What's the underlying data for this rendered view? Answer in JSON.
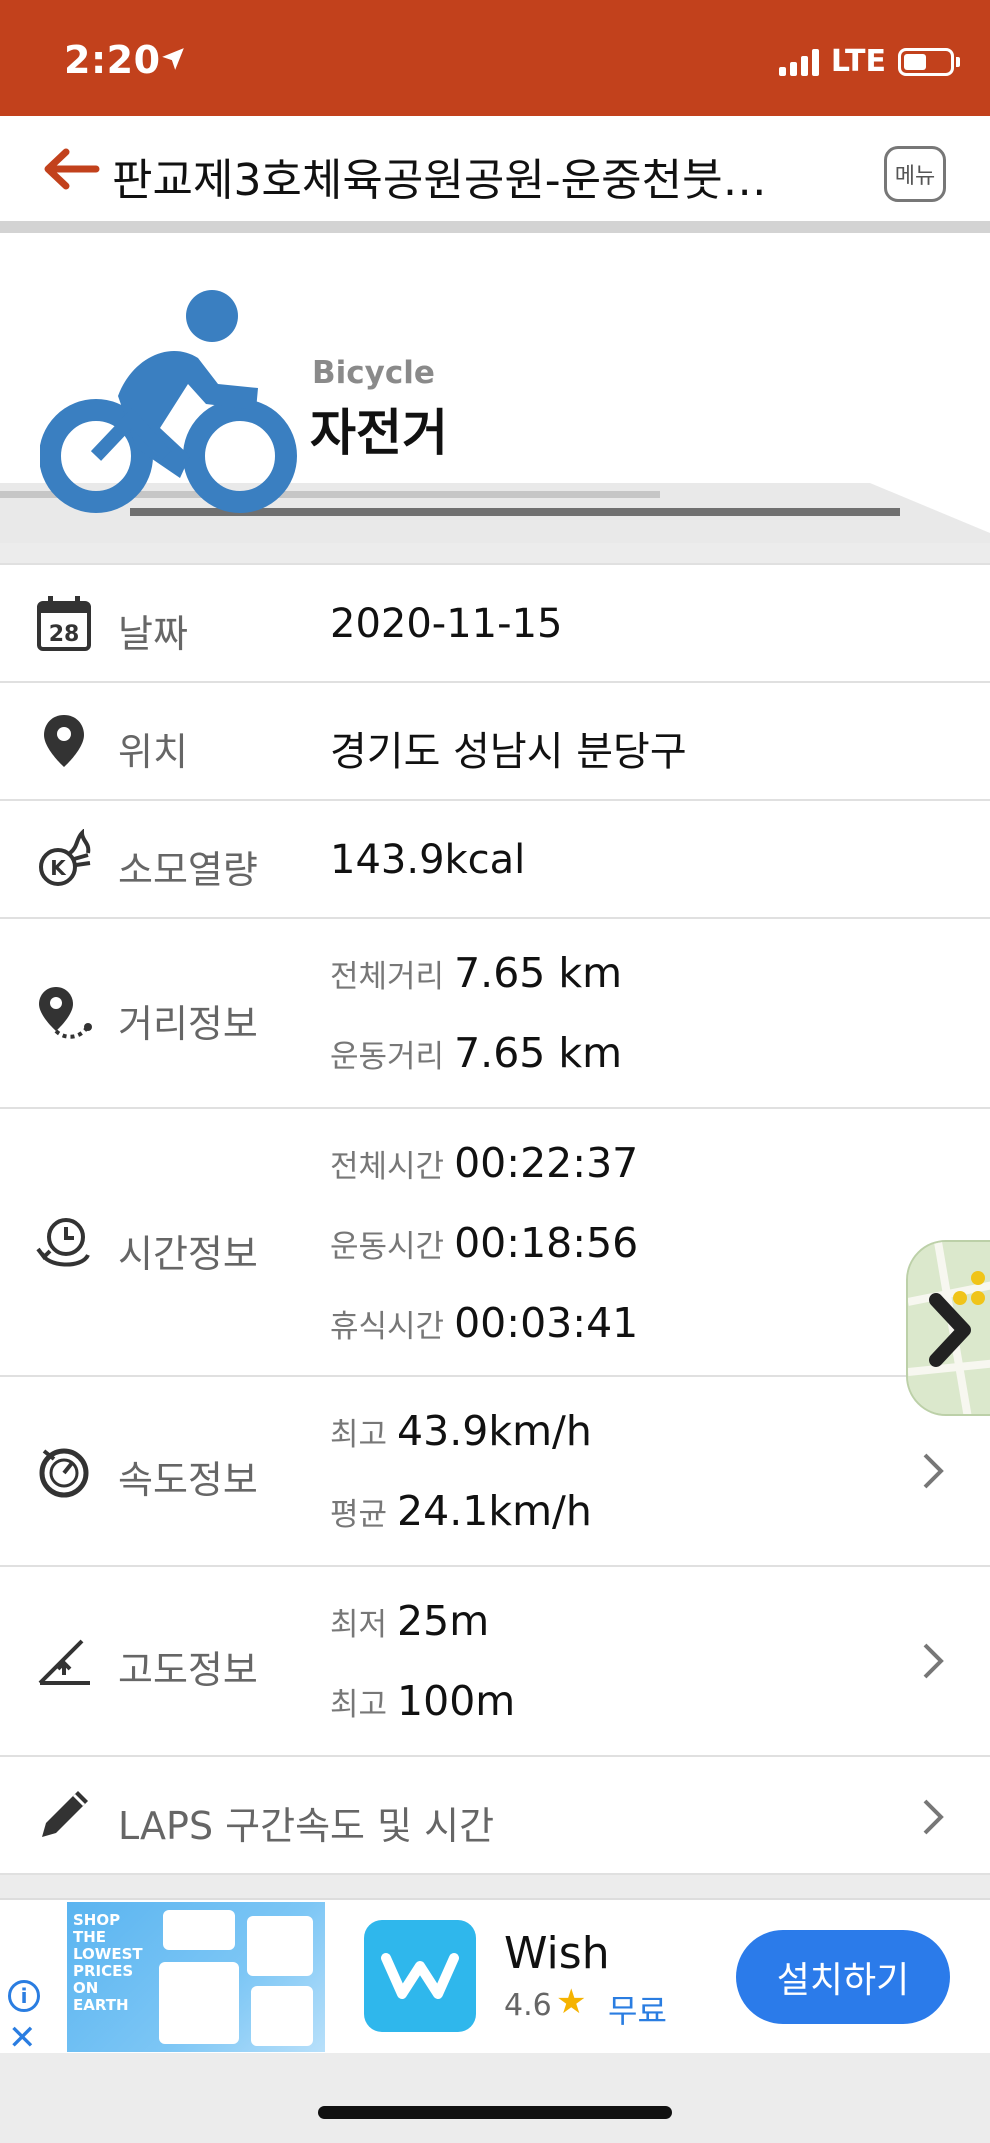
{
  "status_bar": {
    "time": "2:20",
    "network": "LTE",
    "icons": [
      "location-arrow-icon",
      "signal-icon",
      "battery-icon"
    ]
  },
  "nav": {
    "title": "판교제3호체육공원공원-운중천붓…",
    "menu_label": "메뉴",
    "back_icon": "arrow-left-icon"
  },
  "activity": {
    "subtitle": "Bicycle",
    "title": "자전거",
    "icon": "bicycle-rider-icon",
    "accent": "#3a7fc1"
  },
  "rows": {
    "date": {
      "label": "날짜",
      "value": "2020-11-15",
      "icon_day": "28"
    },
    "location": {
      "label": "위치",
      "value": "경기도 성남시 분당구"
    },
    "calories": {
      "label": "소모열량",
      "value": "143.9kcal",
      "icon_letter": "K"
    },
    "distance": {
      "label": "거리정보",
      "total_key": "전체거리",
      "total_val": "7.65 km",
      "moving_key": "운동거리",
      "moving_val": "7.65 km"
    },
    "time": {
      "label": "시간정보",
      "total_key": "전체시간",
      "total_val": "00:22:37",
      "moving_key": "운동시간",
      "moving_val": "00:18:56",
      "rest_key": "휴식시간",
      "rest_val": "00:03:41"
    },
    "speed": {
      "label": "속도정보",
      "max_key": "최고",
      "max_val": "43.9km/h",
      "avg_key": "평균",
      "avg_val": "24.1km/h"
    },
    "altitude": {
      "label": "고도정보",
      "min_key": "최저",
      "min_val": "25m",
      "max_key": "최고",
      "max_val": "100m"
    },
    "laps": {
      "label": "LAPS 구간속도 및 시간"
    }
  },
  "ad": {
    "banner_text": "SHOP\nTHE\nLOWEST\nPRICES\nON\nEARTH",
    "app_name": "Wish",
    "rating": "4.6",
    "price": "무료",
    "install_label": "설치하기",
    "info_glyph": "i",
    "close_glyph": "✕",
    "brand_color": "#2fb7ec"
  },
  "colors": {
    "status_bar": "#c2411c",
    "primary_blue": "#2b7bea"
  }
}
